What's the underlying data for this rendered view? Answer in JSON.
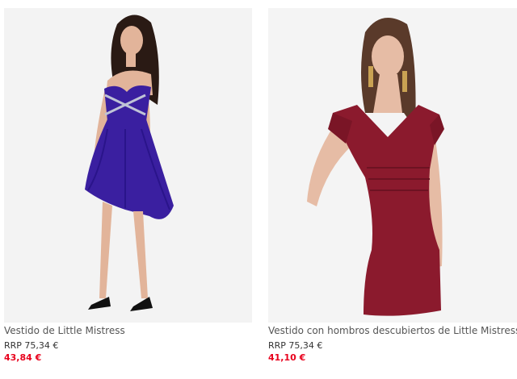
{
  "colors": {
    "sale_price": "#e8001c",
    "dress_left": "#3a1fa0",
    "dress_right": "#8b1a2d"
  },
  "products": [
    {
      "name": "Vestido de Little Mistress",
      "rrp": "RRP 75,34 €",
      "price": "43,84 €",
      "image": "model-in-blue-strapless-dress"
    },
    {
      "name": "Vestido con hombros descubiertos de Little Mistress",
      "rrp": "RRP 75,34 €",
      "price": "41,10 €",
      "image": "model-in-burgundy-off-shoulder-dress"
    }
  ]
}
